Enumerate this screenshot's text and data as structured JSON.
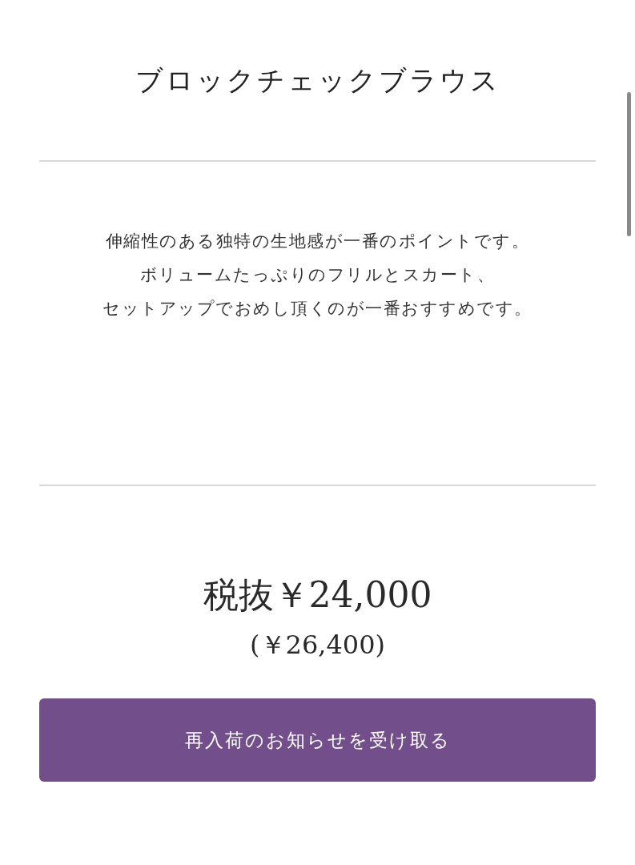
{
  "product": {
    "title": "ブロックチェックブラウス",
    "description_lines": [
      "伸縮性のある独特の生地感が一番のポイントです。",
      "ボリュームたっぷりのフリルとスカート、",
      "セットアップでおめし頂くのが一番おすすめです。"
    ],
    "price": "税抜￥24,000",
    "price_with_tax": "(￥26,400)"
  },
  "button": {
    "label": "再入荷のお知らせを受け取る"
  }
}
